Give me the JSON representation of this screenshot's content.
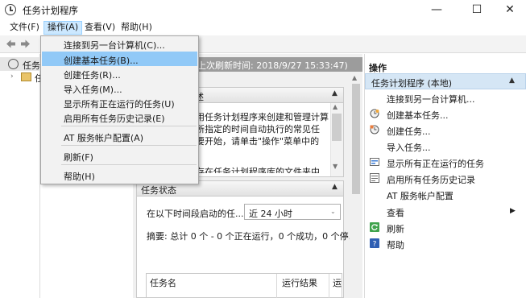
{
  "window": {
    "title": "任务计划程序",
    "minimize": "—",
    "maximize": "☐",
    "close": "✕"
  },
  "menubar": {
    "items": [
      "文件(F)",
      "操作(A)",
      "查看(V)",
      "帮助(H)"
    ],
    "active": "操作(A)"
  },
  "dropdown": {
    "items": [
      "连接到另一台计算机(C)...",
      "创建基本任务(B)...",
      "创建任务(R)...",
      "导入任务(M)...",
      "显示所有正在运行的任务(U)",
      "启用所有任务历史记录(E)",
      "AT 服务帐户配置(A)",
      "刷新(F)",
      "帮助(H)"
    ],
    "highlighted": "创建基本任务(B)..."
  },
  "tree": {
    "root_label": "任务",
    "child_label": "任",
    "expander": "›"
  },
  "main": {
    "last_refresh": "上次刷新时间: 2018/9/27 15:33:47)",
    "overview": {
      "title": "述",
      "lines": [
        "用任务计划程序来创建和管理计算",
        "所指定的时间自动执行的常见任",
        "要开始，请单击\"操作\"菜单中的",
        "存在任务计划程序库的文件夹中"
      ]
    },
    "status": {
      "title": "任务状态",
      "period_label": "在以下时间段启动的任...",
      "period_value": "近 24 小时",
      "summary": "摘要: 总计 0 个 - 0 个正在运行，0 个成功，0 个停...",
      "columns": [
        "任务名",
        "运行结果",
        "运"
      ]
    }
  },
  "actions": {
    "title": "操作",
    "group": "任务计划程序 (本地)",
    "items": [
      "连接到另一台计算机...",
      "创建基本任务...",
      "创建任务...",
      "导入任务...",
      "显示所有正在运行的任务",
      "启用所有任务历史记录",
      "AT 服务帐户配置",
      "查看",
      "刷新",
      "帮助"
    ]
  },
  "glyphs": {
    "collapse": "▲",
    "chevron_down": "⌄",
    "submenu": "▶",
    "scroll_up": "▲",
    "scroll_down": "▼"
  },
  "colors": {
    "menu_highlight": "#91c9f7",
    "actions_group_bg": "#d5e6f5",
    "header_band": "#9c9c9c"
  }
}
